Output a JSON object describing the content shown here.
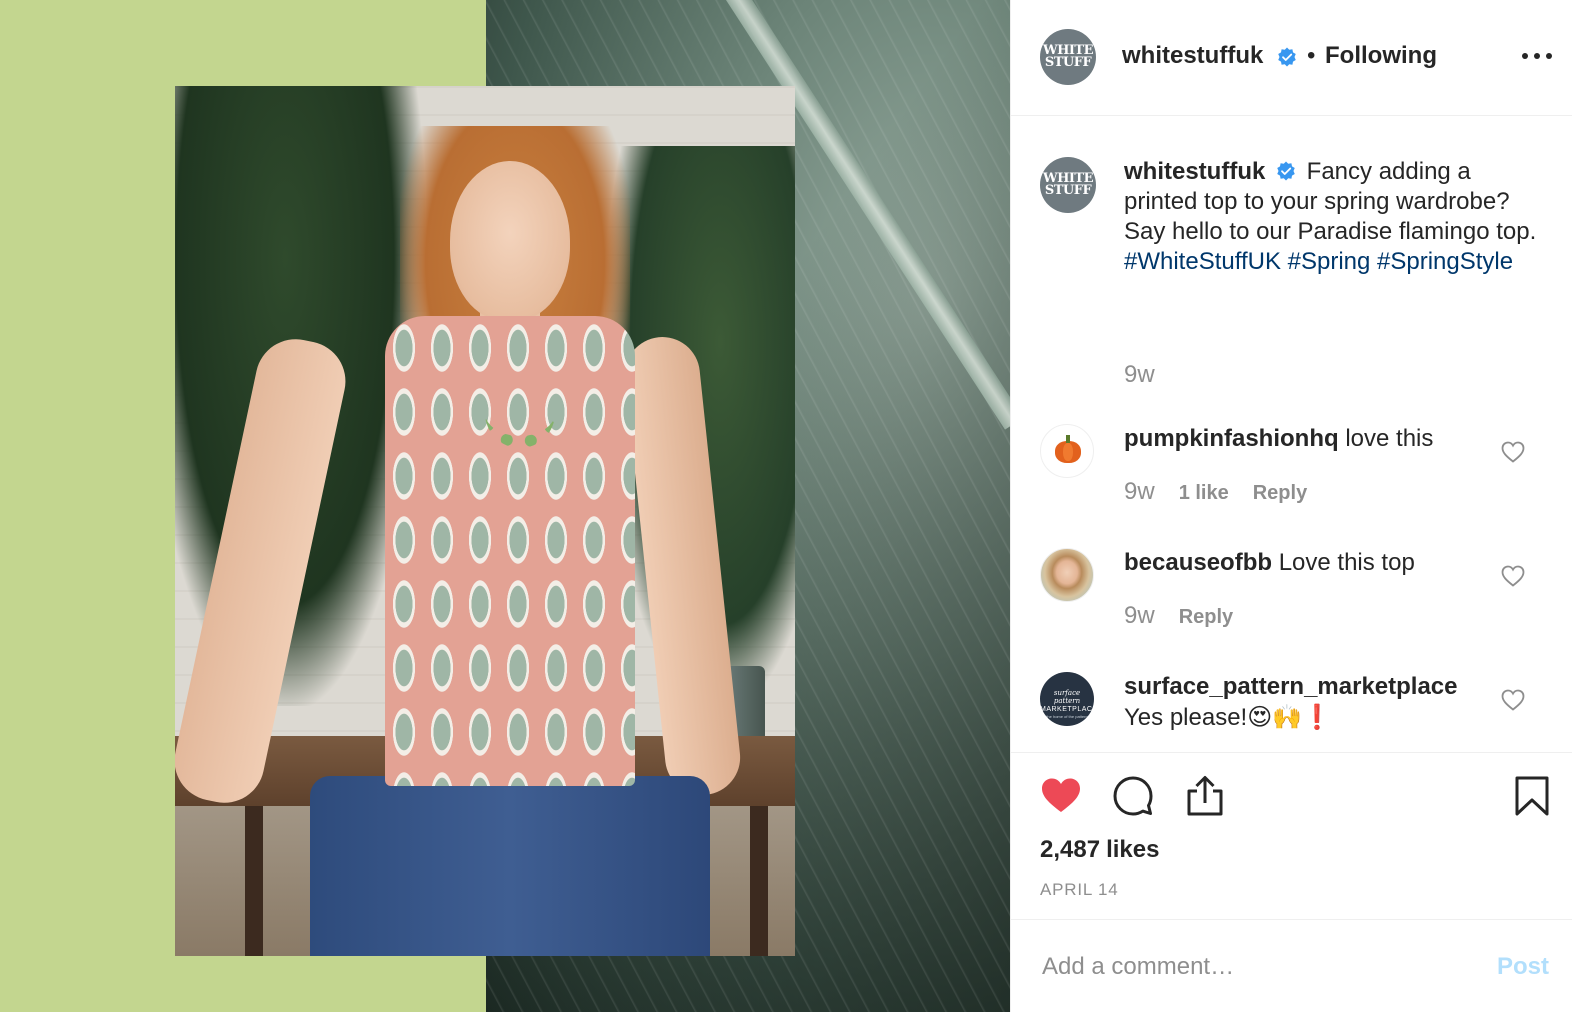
{
  "post": {
    "author": {
      "username": "whitestuffuk",
      "avatar_text_line1": "WHITE",
      "avatar_text_line2": "STUFF",
      "verified": true
    },
    "header": {
      "separator": "•",
      "follow_status": "Following",
      "more_icon": "more-options-icon"
    },
    "caption": {
      "username": "whitestuffuk",
      "text": "Fancy adding a printed top to your spring wardrobe? Say hello to our Paradise flamingo top.",
      "hashtags": "#WhiteStuffUK #Spring #SpringStyle",
      "time": "9w"
    },
    "comments": [
      {
        "username": "pumpkinfashionhq",
        "text": "love this",
        "time": "9w",
        "likes": "1 like",
        "reply": "Reply",
        "avatar": "pumpkin-avatar"
      },
      {
        "username": "becauseofbb",
        "text": "Love this top",
        "time": "9w",
        "reply": "Reply",
        "avatar": "photo-avatar"
      },
      {
        "username": "surface_pattern_marketplace",
        "text": "Yes please!",
        "emojis": "😍🙌❗",
        "avatar_line1": "surface pattern",
        "avatar_line2": "MARKETPLACE",
        "avatar_line3": "the home of the pattern",
        "avatar": "brand-avatar"
      }
    ],
    "actions": {
      "liked": true,
      "like_icon": "heart-filled-icon",
      "comment_icon": "comment-icon",
      "share_icon": "share-icon",
      "save_icon": "bookmark-icon",
      "likes_count": "2,487",
      "likes_label": "likes",
      "date": "APRIL 14"
    },
    "add_comment": {
      "placeholder": "Add a comment…",
      "post_label": "Post"
    }
  },
  "colors": {
    "text_primary": "#262626",
    "text_secondary": "#8e8e8e",
    "hashtag": "#00376b",
    "verified_blue": "#3897f0",
    "like_red": "#ed4956",
    "post_disabled": "#b2dffc",
    "border": "#efefef",
    "backdrop_green": "#c3d68f"
  }
}
